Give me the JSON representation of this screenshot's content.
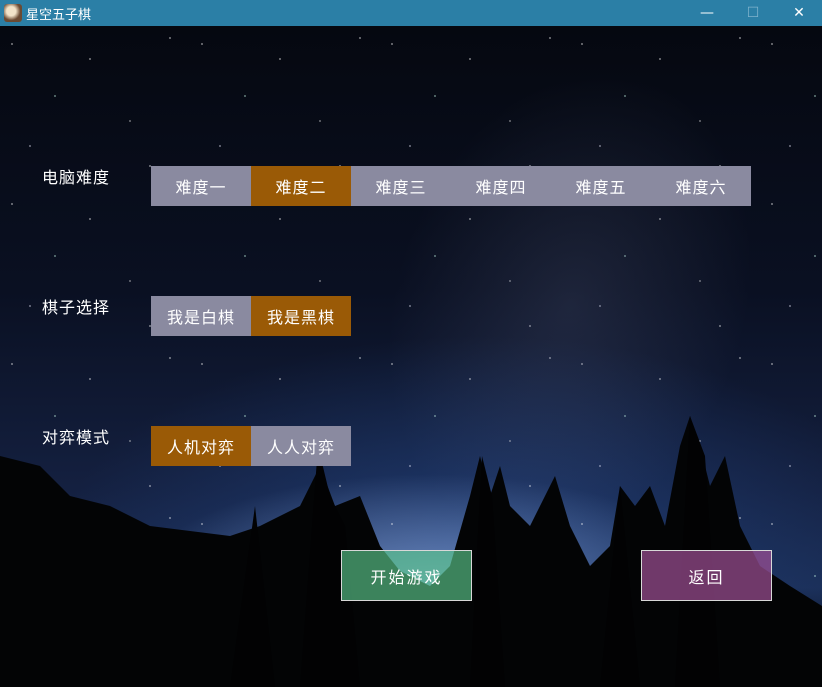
{
  "window": {
    "title": "星空五子棋",
    "minimize_glyph": "—",
    "maximize_glyph": "☐",
    "close_glyph": "✕"
  },
  "settings": {
    "difficulty": {
      "label": "电脑难度",
      "options": [
        "难度一",
        "难度二",
        "难度三",
        "难度四",
        "难度五",
        "难度六"
      ],
      "selected_index": 1
    },
    "piece": {
      "label": "棋子选择",
      "options": [
        "我是白棋",
        "我是黑棋"
      ],
      "selected_index": 1
    },
    "mode": {
      "label": "对弈模式",
      "options": [
        "人机对弈",
        "人人对弈"
      ],
      "selected_index": 0
    }
  },
  "actions": {
    "start_label": "开始游戏",
    "back_label": "返回"
  },
  "colors": {
    "titlebar": "#2b7fa6",
    "option_default": "#8a8aa0",
    "option_selected": "#9a5a06",
    "start_button": "#5ac88c",
    "back_button": "#a05096"
  },
  "icons": {
    "app": "app-icon",
    "minimize": "minimize-icon",
    "maximize": "maximize-icon",
    "close": "close-icon"
  }
}
